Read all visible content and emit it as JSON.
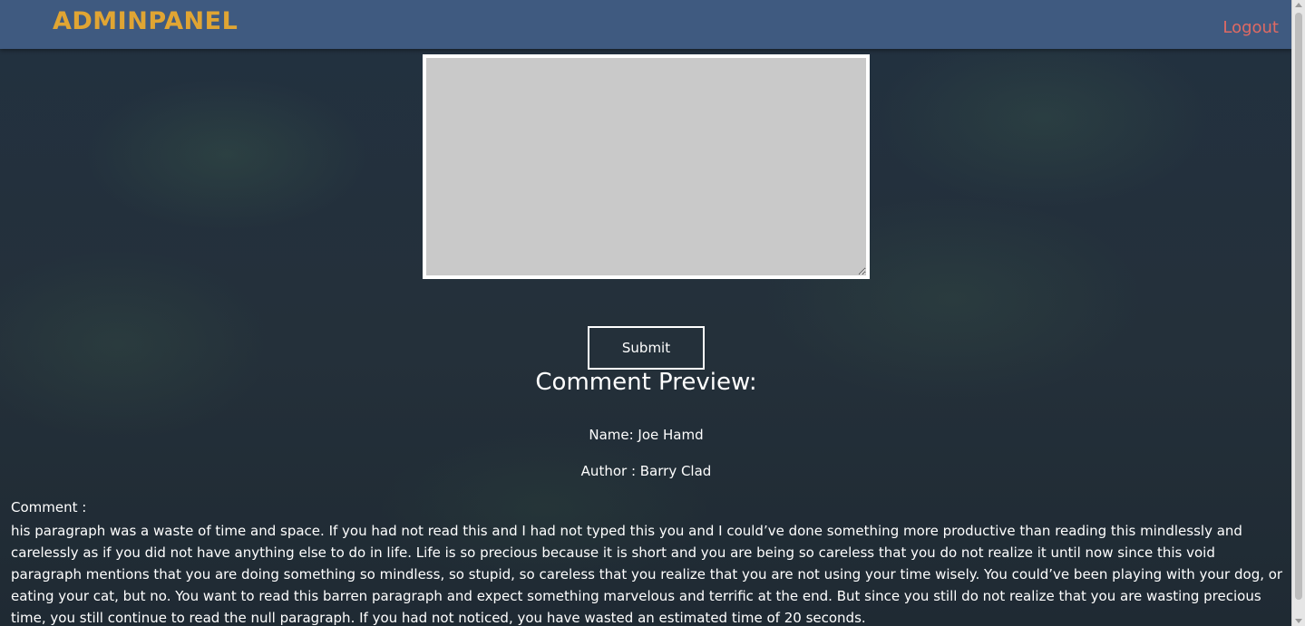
{
  "header": {
    "brand": "ADMINPANEL",
    "logout_label": "Logout"
  },
  "form": {
    "comment_value": "",
    "submit_label": "Submit"
  },
  "preview": {
    "title": "Comment Preview:",
    "name_line": "Name: Joe Hamd",
    "author_line": "Author : Barry Clad",
    "comment_label": "Comment :",
    "comment_text": "his paragraph was a waste of time and space. If you had not read this and I had not typed this you and I could’ve done something more productive than reading this mindlessly and carelessly as if you did not have anything else to do in life. Life is so precious because it is short and you are being so careless that you do not realize it until now since this void paragraph mentions that you are doing something so mindless, so stupid, so careless that you realize that you are not using your time wisely. You could’ve been playing with your dog, or eating your cat, but no. You want to read this barren paragraph and expect something marvelous and terrific at the end. But since you still do not realize that you are wasting precious time, you still continue to read the null paragraph. If you had not noticed, you have wasted an estimated time of 20 seconds."
  },
  "colors": {
    "header_bg": "#3f5a80",
    "brand": "#e0a533",
    "logout": "#e06a63",
    "page_bg": "#26303b",
    "textarea_bg": "#c9c9c9"
  }
}
